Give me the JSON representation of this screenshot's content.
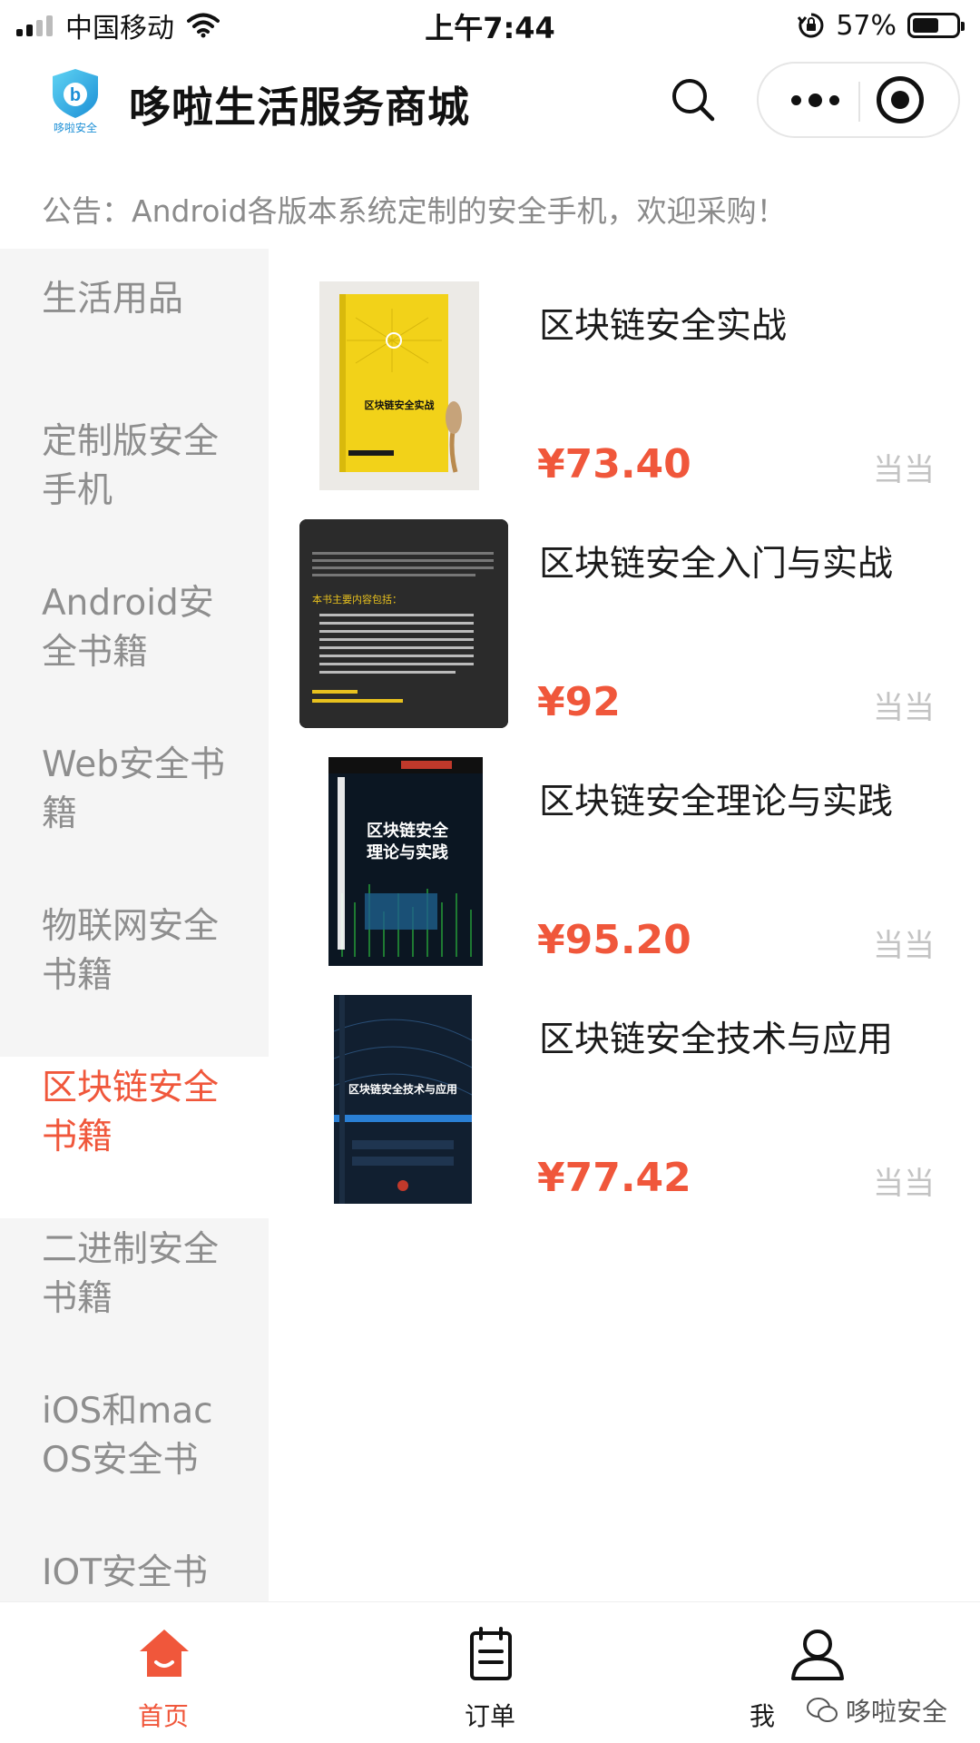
{
  "status_bar": {
    "carrier": "中国移动",
    "time": "上午7:44",
    "battery": "57%"
  },
  "header": {
    "logo_text": "哆啦安全",
    "title": "哆啦生活服务商城"
  },
  "notice": "公告：Android各版本系统定制的安全手机，欢迎采购！",
  "sidebar": {
    "items": [
      {
        "label": "生活用品"
      },
      {
        "label": "定制版安全手机"
      },
      {
        "label": "Android安全书籍"
      },
      {
        "label": "Web安全书籍"
      },
      {
        "label": "物联网安全书籍"
      },
      {
        "label": "区块链安全书籍"
      },
      {
        "label": "二进制安全书籍"
      },
      {
        "label": "iOS和macOS安全书"
      },
      {
        "label": "IOT安全书籍"
      }
    ],
    "active_index": 5
  },
  "products": [
    {
      "name": "区块链安全实战",
      "price": "¥73.40",
      "store": "当当",
      "cover_title": "区块链安全实战"
    },
    {
      "name": "区块链安全入门与实战",
      "price": "¥92",
      "store": "当当",
      "cover_title": "本书主要内容包括："
    },
    {
      "name": "区块链安全理论与实践",
      "price": "¥95.20",
      "store": "当当",
      "cover_title": "区块链安全理论与实践"
    },
    {
      "name": "区块链安全技术与应用",
      "price": "¥77.42",
      "store": "当当",
      "cover_title": "区块链安全技术与应用"
    }
  ],
  "tab_bar": {
    "tabs": [
      {
        "label": "首页",
        "icon": "home-icon",
        "active": true
      },
      {
        "label": "订单",
        "icon": "order-icon",
        "active": false
      },
      {
        "label": "我",
        "icon": "user-icon",
        "active": false
      }
    ]
  },
  "watermark": "哆啦安全",
  "colors": {
    "accent": "#f0573b",
    "sidebar_bg": "#f5f5f5",
    "muted_text": "#8e8e8e"
  }
}
